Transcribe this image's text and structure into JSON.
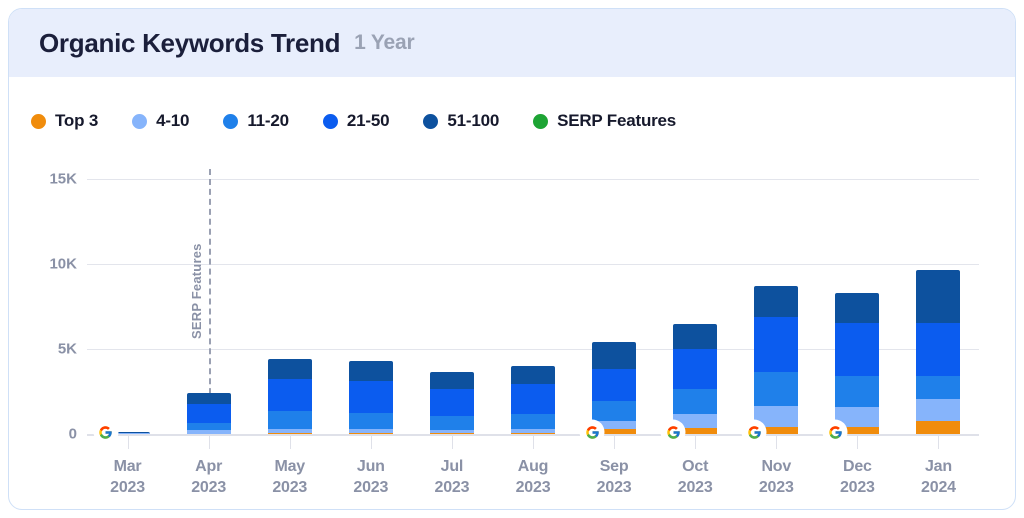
{
  "header": {
    "title": "Organic Keywords Trend",
    "period": "1 Year"
  },
  "legend": [
    {
      "label": "Top 3",
      "color": "#F08C0C"
    },
    {
      "label": "4-10",
      "color": "#86B4FB"
    },
    {
      "label": "11-20",
      "color": "#1F80EA"
    },
    {
      "label": "21-50",
      "color": "#0B5CEF"
    },
    {
      "label": "51-100",
      "color": "#0D519E"
    },
    {
      "label": "SERP Features",
      "color": "#1DA434"
    }
  ],
  "annotation": {
    "label": "SERP Features",
    "at_category": "Apr 2023"
  },
  "axis": {
    "y_ticks": [
      "15K",
      "10K",
      "5K",
      "0"
    ],
    "x_labels": [
      {
        "month": "Mar",
        "year": "2023"
      },
      {
        "month": "Apr",
        "year": "2023"
      },
      {
        "month": "May",
        "year": "2023"
      },
      {
        "month": "Jun",
        "year": "2023"
      },
      {
        "month": "Jul",
        "year": "2023"
      },
      {
        "month": "Aug",
        "year": "2023"
      },
      {
        "month": "Sep",
        "year": "2023"
      },
      {
        "month": "Oct",
        "year": "2023"
      },
      {
        "month": "Nov",
        "year": "2023"
      },
      {
        "month": "Dec",
        "year": "2023"
      },
      {
        "month": "Jan",
        "year": "2024"
      }
    ]
  },
  "google_markers": [
    "Mar 2023",
    "Sep 2023",
    "Oct 2023",
    "Nov 2023",
    "Dec 2023"
  ],
  "chart_data": {
    "type": "bar",
    "stacked": true,
    "title": "Organic Keywords Trend",
    "subtitle": "1 Year",
    "xlabel": "",
    "ylabel": "",
    "ylim": [
      0,
      15000
    ],
    "y_ticks": [
      0,
      5000,
      10000,
      15000
    ],
    "grid": true,
    "legend_position": "top-left",
    "categories": [
      "Mar 2023",
      "Apr 2023",
      "May 2023",
      "Jun 2023",
      "Jul 2023",
      "Aug 2023",
      "Sep 2023",
      "Oct 2023",
      "Nov 2023",
      "Dec 2023",
      "Jan 2024"
    ],
    "series": [
      {
        "name": "Top 3",
        "color": "#F08C0C",
        "values": [
          20,
          25,
          30,
          30,
          30,
          40,
          300,
          350,
          400,
          400,
          760
        ]
      },
      {
        "name": "4-10",
        "color": "#86B4FB",
        "values": [
          20,
          230,
          250,
          250,
          230,
          260,
          460,
          820,
          1250,
          1200,
          1280
        ]
      },
      {
        "name": "11-20",
        "color": "#1F80EA",
        "values": [
          30,
          390,
          1090,
          980,
          800,
          900,
          1160,
          1470,
          2000,
          1830,
          1400
        ]
      },
      {
        "name": "21-50",
        "color": "#0B5CEF",
        "values": [
          20,
          1120,
          1880,
          1860,
          1600,
          1750,
          1880,
          2360,
          3230,
          3100,
          3120
        ]
      },
      {
        "name": "51-100",
        "color": "#0D519E",
        "values": [
          10,
          650,
          1150,
          1180,
          990,
          1050,
          1600,
          1500,
          1820,
          1770,
          3090
        ]
      }
    ],
    "totals": [
      100,
      2415,
      4400,
      4300,
      3650,
      4000,
      5400,
      6500,
      8700,
      8300,
      9650
    ],
    "annotations": [
      {
        "text": "SERP Features",
        "type": "vertical-dashed-line",
        "x": "Apr 2023"
      }
    ]
  }
}
